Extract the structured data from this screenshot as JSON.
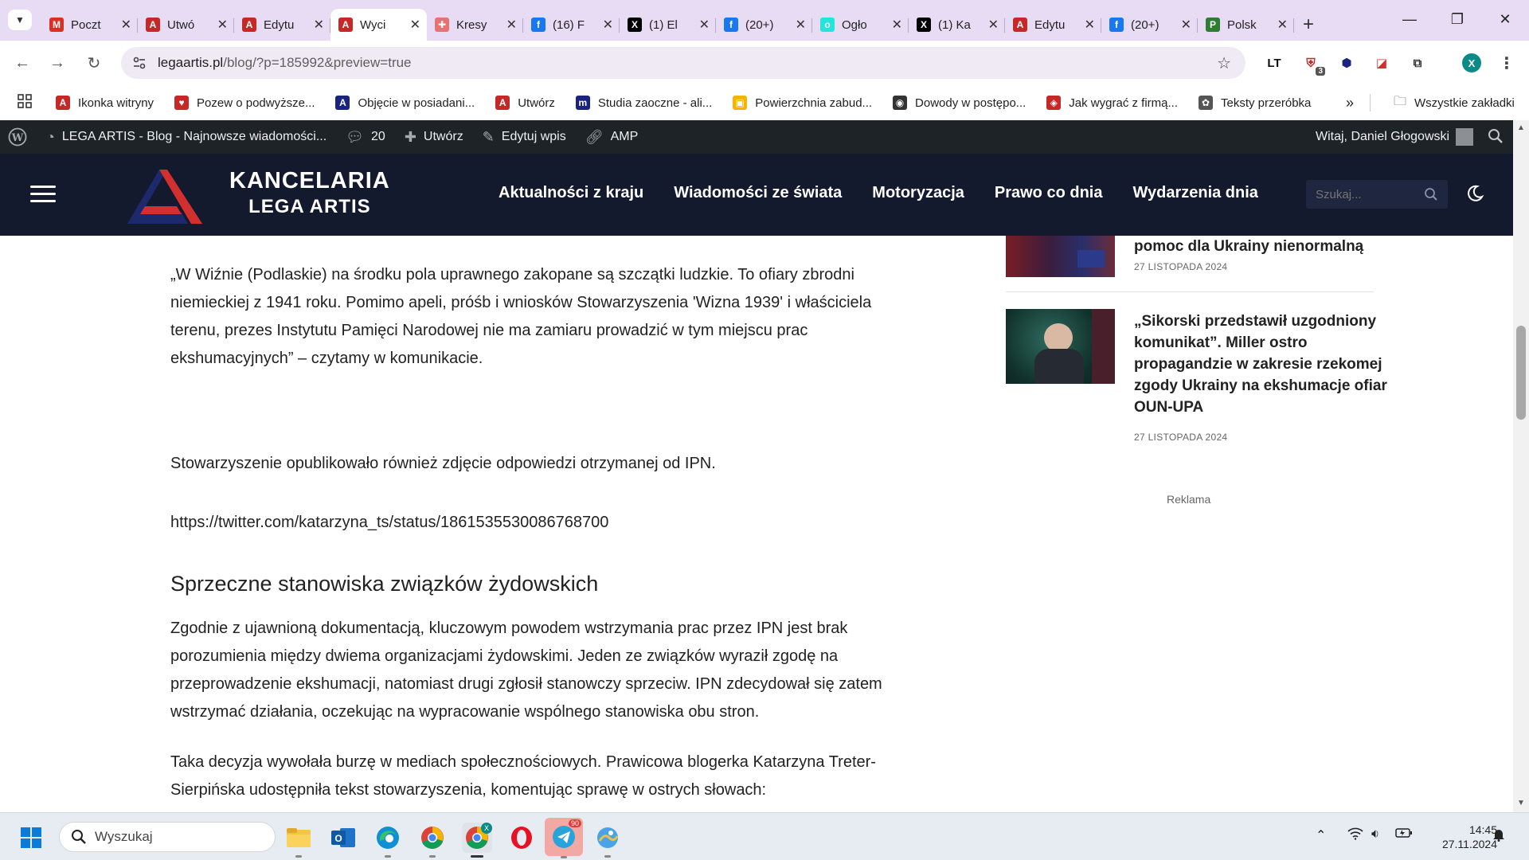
{
  "browser": {
    "tabs": [
      {
        "title": "Poczt",
        "icon": "gmail-icon",
        "color": "#d93025",
        "glyph": "M"
      },
      {
        "title": "Utwó",
        "icon": "lega-artis-icon",
        "color": "#c62828",
        "glyph": "A"
      },
      {
        "title": "Edytu",
        "icon": "lega-artis-icon",
        "color": "#c62828",
        "glyph": "A"
      },
      {
        "title": "Wyci",
        "icon": "lega-artis-icon",
        "color": "#c62828",
        "glyph": "A",
        "active": true
      },
      {
        "title": "Kresy",
        "icon": "kresy-icon",
        "color": "#e57373",
        "glyph": "✚"
      },
      {
        "title": "(16) F",
        "icon": "facebook-icon",
        "color": "#1877f2",
        "glyph": "f"
      },
      {
        "title": "(1) El",
        "icon": "x-twitter-icon",
        "color": "#000000",
        "glyph": "X"
      },
      {
        "title": "(20+)",
        "icon": "facebook-icon",
        "color": "#1877f2",
        "glyph": "f"
      },
      {
        "title": "Ogło",
        "icon": "olx-icon",
        "color": "#23e5db",
        "glyph": "o"
      },
      {
        "title": "(1) Ka",
        "icon": "x-twitter-icon",
        "color": "#000000",
        "glyph": "X"
      },
      {
        "title": "Edytu",
        "icon": "lega-artis-icon",
        "color": "#c62828",
        "glyph": "A"
      },
      {
        "title": "(20+)",
        "icon": "facebook-icon",
        "color": "#1877f2",
        "glyph": "f"
      },
      {
        "title": "Polsk",
        "icon": "polsk-icon",
        "color": "#2e7d32",
        "glyph": "P"
      }
    ],
    "url_host": "legaartis.pl",
    "url_path": "/blog/?p=185992&preview=true",
    "extension_badge": "3",
    "profile_initial": "X"
  },
  "bookmarks": [
    {
      "label": "Ikonka witryny",
      "color": "#c62828",
      "glyph": "A"
    },
    {
      "label": "Pozew o podwyższe...",
      "color": "#c62828",
      "glyph": "♥"
    },
    {
      "label": "Objęcie w posiadani...",
      "color": "#1a237e",
      "glyph": "A"
    },
    {
      "label": "Utwórz",
      "color": "#c62828",
      "glyph": "A"
    },
    {
      "label": "Studia zaoczne - ali...",
      "color": "#1a237e",
      "glyph": "m"
    },
    {
      "label": "Powierzchnia zabud...",
      "color": "#f4b400",
      "glyph": "▣"
    },
    {
      "label": "Dowody w postępo...",
      "color": "#333333",
      "glyph": "◉"
    },
    {
      "label": "Jak wygrać z firmą...",
      "color": "#c62828",
      "glyph": "◈"
    },
    {
      "label": "Teksty przeróbka",
      "color": "#555555",
      "glyph": "✿"
    }
  ],
  "bookmarks_all": "Wszystkie zakładki",
  "wpbar": {
    "site": "LEGA ARTIS - Blog - Najnowsze wiadomości...",
    "comments": "20",
    "new": "Utwórz",
    "edit": "Edytuj wpis",
    "amp": "AMP",
    "greeting": "Witaj, Daniel Głogowski"
  },
  "site": {
    "logo_line1": "KANCELARIA",
    "logo_line2": "LEGA ARTIS",
    "nav": [
      "Aktualności z kraju",
      "Wiadomości ze świata",
      "Motoryzacja",
      "Prawo co dnia",
      "Wydarzenia dnia"
    ],
    "search_placeholder": "Szukaj..."
  },
  "article": {
    "quote_lines": [
      "„W Wiźnie (Podlaskie) na środku pola uprawnego zakopane są szczątki ludzkie. To ofiary zbrodni",
      "niemieckiej z 1941 roku. Pomimo apeli, próśb i wniosków Stowarzyszenia 'Wizna 1939' i właściciela",
      "terenu, prezes Instytutu Pamięci Narodowej nie ma zamiaru prowadzić w tym miejscu prac",
      "ekshumacyjnych” – czytamy w komunikacie."
    ],
    "p2": "Stowarzyszenie opublikowało również zdjęcie odpowiedzi otrzymanej od IPN.",
    "link": "https://twitter.com/katarzyna_ts/status/1861535530086768700",
    "heading": "Sprzeczne stanowiska związków żydowskich",
    "p3_lines": [
      "Zgodnie z ujawnioną dokumentacją, kluczowym powodem wstrzymania prac przez IPN jest brak",
      "porozumienia między dwiema organizacjami żydowskimi. Jeden ze związków wyraził zgodę na",
      "przeprowadzenie ekshumacji, natomiast drugi zgłosił stanowczy sprzeciw. IPN zdecydował się zatem",
      "wstrzymać działania, oczekując na wypracowanie wspólnego stanowiska obu stron."
    ],
    "p4_lines": [
      "Taka decyzja wywołała burzę w mediach społecznościowych. Prawicowa blogerka Katarzyna Treter-",
      "Sierpińska udostępniła tekst stowarzyszenia, komentując sprawę w ostrych słowach:"
    ]
  },
  "sidebar": {
    "item1_title_tail": "pomoc dla Ukrainy nienormalną",
    "item1_date": "27 LISTOPADA 2024",
    "item2_title_lines": [
      "„Sikorski przedstawił uzgodniony",
      "komunikat”. Miller ostro",
      "propagandzie w zakresie rzekomej",
      "zgody Ukrainy na ekshumacje ofiar",
      "OUN-UPA"
    ],
    "item2_date": "27 LISTOPADA 2024",
    "ad_label": "Reklama"
  },
  "taskbar": {
    "search_label": "Wyszukaj",
    "telegram_badge": "90",
    "chrome_badge": "X",
    "time": "14:45",
    "date": "27.11.2024"
  }
}
